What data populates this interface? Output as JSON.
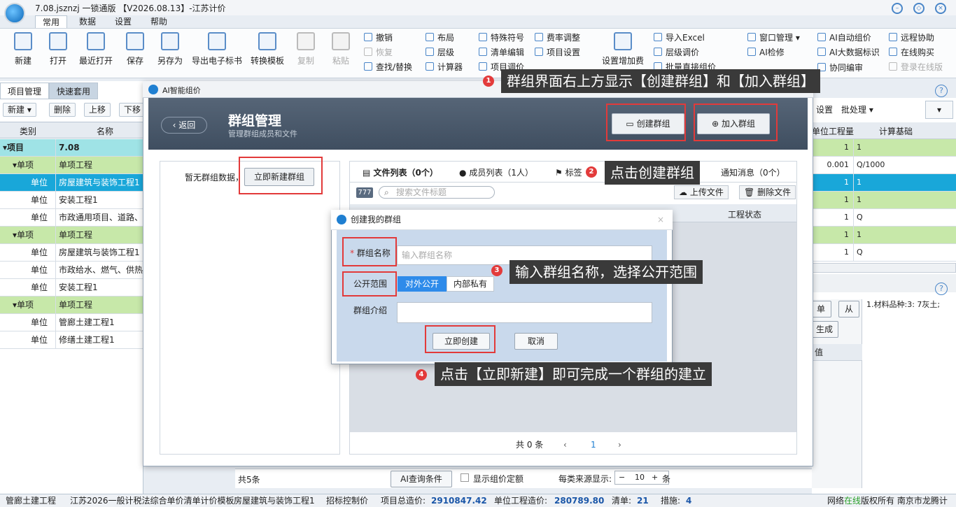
{
  "window": {
    "title": "7.08.jsznzj  一锁通版  【V2026.08.13】-江苏计价",
    "menu_tabs": [
      "常用",
      "数据",
      "设置",
      "帮助"
    ]
  },
  "ribbon": {
    "big_buttons": [
      "新建",
      "打开",
      "最近打开",
      "保存",
      "另存为",
      "导出电子标书",
      "转换模板",
      "复制",
      "粘贴"
    ],
    "col1": [
      "撤销",
      "恢复",
      "查找/替换"
    ],
    "col2": [
      "布局",
      "层级",
      "计算器"
    ],
    "col3": [
      "特殊符号",
      "清单编辑",
      "项目调价"
    ],
    "col4": [
      "费率调整",
      "项目设置"
    ],
    "fee_button": "设置增加费",
    "col5": [
      "导入Excel",
      "层级调价",
      "批量直接组价"
    ],
    "col6": [
      "窗口管理",
      "AI检修"
    ],
    "col7": [
      "AI自动组价",
      "AI大数据标识"
    ],
    "col8": [
      "远程协助",
      "在线购买",
      "登录在线版"
    ],
    "col7_extra": "协同编审"
  },
  "left_panel": {
    "tabs": [
      "项目管理",
      "快速套用"
    ],
    "toolbar": [
      "新建",
      "删除",
      "上移",
      "下移"
    ],
    "columns": [
      "类别",
      "名称"
    ],
    "rows": [
      {
        "type": "项目",
        "name": "7.08"
      },
      {
        "type": "单项",
        "name": "单项工程"
      },
      {
        "type": "单位",
        "name": "房屋建筑与装饰工程1"
      },
      {
        "type": "单位",
        "name": "安装工程1"
      },
      {
        "type": "单位",
        "name": "市政通用项目、道路、"
      },
      {
        "type": "单项",
        "name": "单项工程"
      },
      {
        "type": "单位",
        "name": "房屋建筑与装饰工程1"
      },
      {
        "type": "单位",
        "name": "市政给水、燃气、供热"
      },
      {
        "type": "单位",
        "name": "安装工程1"
      },
      {
        "type": "单项",
        "name": "单项工程"
      },
      {
        "type": "单位",
        "name": "管廊土建工程1"
      },
      {
        "type": "单位",
        "name": "修缮土建工程1"
      }
    ]
  },
  "right_grid": {
    "toolbar": [
      "设置",
      "批处理"
    ],
    "columns": [
      "单位工程量",
      "计算基础"
    ],
    "rows": [
      {
        "a": "1",
        "b": "1"
      },
      {
        "a": "0.001",
        "b": "Q/1000"
      },
      {
        "a": "1",
        "b": "1"
      },
      {
        "a": "1",
        "b": "1"
      },
      {
        "a": "1",
        "b": "Q"
      },
      {
        "a": "1",
        "b": "1"
      },
      {
        "a": "1",
        "b": "Q"
      }
    ],
    "lower_text": "1.材料品种:3: 7灰土;",
    "lower_btn1": "单",
    "lower_btn2": "从",
    "lower_btn3": "生成",
    "lower_col": "值"
  },
  "ai_window": {
    "title": "AI智能组价",
    "back": "返回",
    "header_title": "群组管理",
    "header_sub": "管理群组成员和文件",
    "create_group": "创建群组",
    "join_group": "加入群组",
    "no_group_text": "暂无群组数据，",
    "new_group_button": "立即新建群组",
    "tabs": [
      "文件列表（0个）",
      "成员列表（1人）",
      "标签",
      "通知消息（0个）"
    ],
    "file_badge": "777",
    "search_placeholder": "搜索文件标题",
    "upload_file": "上传文件",
    "delete_file": "删除文件",
    "column_status": "工程状态",
    "pager_total": "共 0 条",
    "pager_page": "1"
  },
  "modal": {
    "title": "创建我的群组",
    "name_label": "群组名称",
    "name_placeholder": "输入群组名称",
    "scope_label": "公开范围",
    "scope_public": "对外公开",
    "scope_private": "内部私有",
    "intro_label": "群组介绍",
    "create_button": "立即创建",
    "cancel_button": "取消"
  },
  "bottom": {
    "count": "共5条",
    "ai_query": "AI查询条件",
    "show_quota": "显示组价定额",
    "per_source": "每类来源显示:",
    "per_source_value": "10",
    "per_source_unit": "条"
  },
  "status_bar": {
    "items": [
      "管廊土建工程",
      "江苏2026一般计税法综合单价清单计价模板",
      "房屋建筑与装饰工程1",
      "招标控制价",
      "项目总造价:",
      "单位工程造价:",
      "清单:",
      "措施:"
    ],
    "total_value": "2910847.42",
    "unit_value": "280789.80",
    "list_value": "21",
    "measure_value": "4",
    "right_text_1": "网络",
    "right_online": "在线",
    "right_text_2": "版权所有  南京市龙腾计"
  },
  "callouts": [
    {
      "num": "1",
      "text": "群组界面右上方显示【创建群组】和【加入群组】"
    },
    {
      "num": "2",
      "text": "点击创建群组"
    },
    {
      "num": "3",
      "text": "输入群组名称，选择公开范围"
    },
    {
      "num": "4",
      "text": "点击【立即新建】即可完成一个群组的建立"
    }
  ],
  "colors": {
    "accent_blue": "#2e8bea",
    "highlight_row": "#19a7d9",
    "project_row": "#9fe3e6",
    "item_row": "#c7e8a9",
    "red_box": "#e23a3a",
    "callout_bg": "#3a3a3a"
  }
}
